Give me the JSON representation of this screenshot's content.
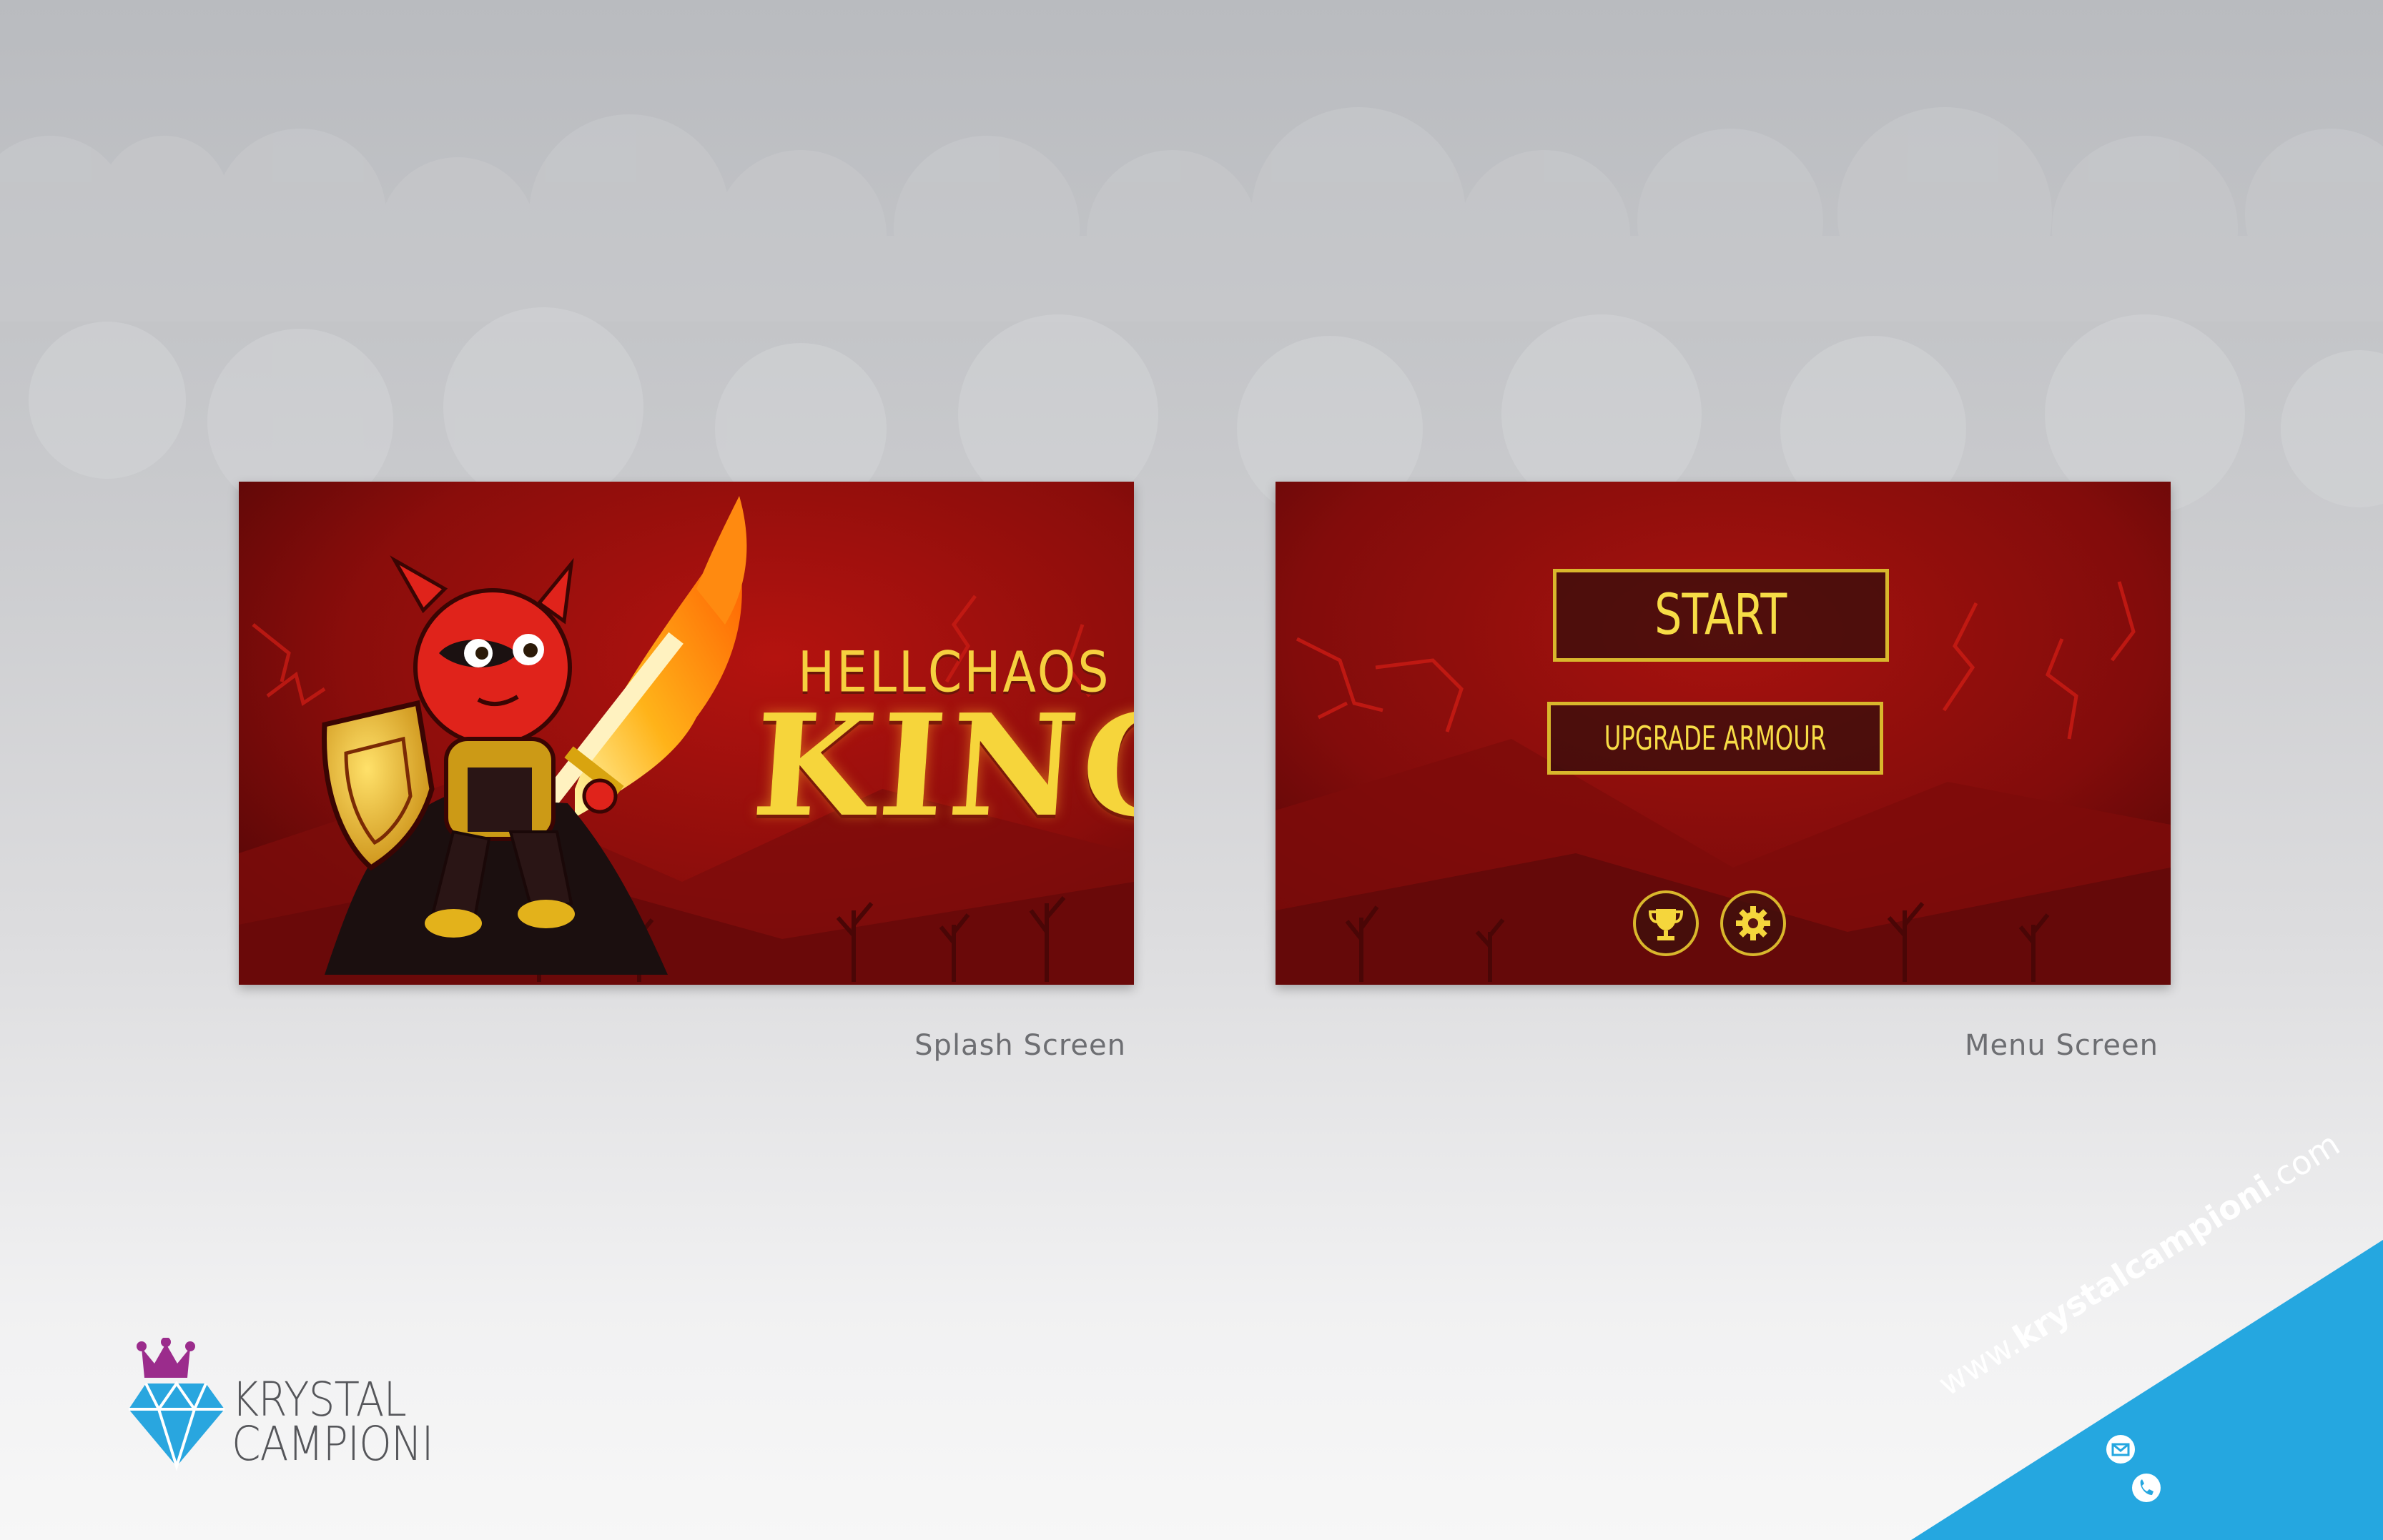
{
  "colors": {
    "background_top": "#b9bbbf",
    "background_bottom": "#f7f7f7",
    "game_red": "#9b1010",
    "gold": "#f6d03f",
    "corner_blue": "#25a7e0",
    "caption_grey": "#6d6e72"
  },
  "splash": {
    "caption": "Splash Screen",
    "title_small": "HELLCHAOS",
    "title_big": "KING",
    "character": "red devil knight with flaming sword and golden shield"
  },
  "menu": {
    "caption": "Menu Screen",
    "start_label": "START",
    "upgrade_label": "UPGRADE ARMOUR",
    "icons": [
      "trophy-icon",
      "gear-icon"
    ]
  },
  "branding": {
    "logo_line1": "KRYSTAL",
    "logo_line2": "CAMPIONI",
    "website_prefix": "www.",
    "website_name": "krystalcampioni",
    "website_suffix": ".com",
    "contact_icons": [
      "mail-icon",
      "phone-icon"
    ]
  }
}
